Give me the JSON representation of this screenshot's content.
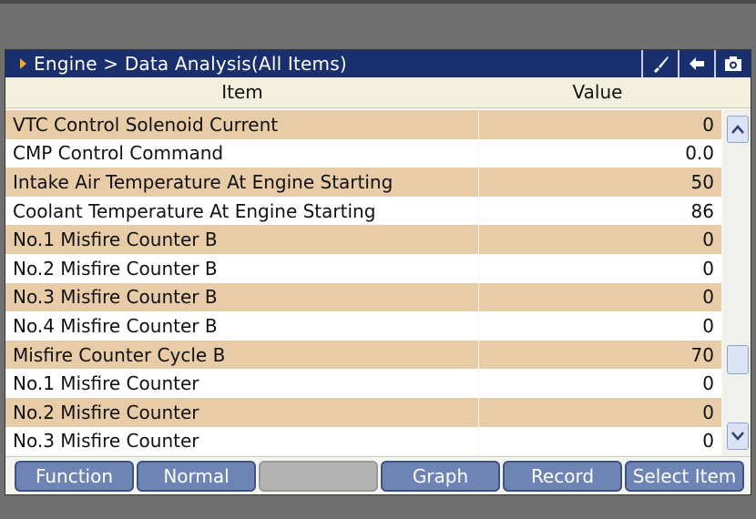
{
  "header": {
    "breadcrumb": "Engine > Data Analysis(All Items)",
    "icons": [
      "brush-icon",
      "back-arrow-icon",
      "camera-icon"
    ]
  },
  "columns": {
    "item": "Item",
    "value": "Value"
  },
  "rows": [
    {
      "item": "VTC Control Solenoid Current",
      "value": "0"
    },
    {
      "item": "CMP Control Command",
      "value": "0.0"
    },
    {
      "item": "Intake Air Temperature At Engine Starting",
      "value": "50"
    },
    {
      "item": "Coolant Temperature At Engine Starting",
      "value": "86"
    },
    {
      "item": "No.1 Misfire Counter B",
      "value": "0"
    },
    {
      "item": "No.2 Misfire Counter B",
      "value": "0"
    },
    {
      "item": "No.3 Misfire Counter B",
      "value": "0"
    },
    {
      "item": "No.4 Misfire Counter B",
      "value": "0"
    },
    {
      "item": "Misfire Counter Cycle B",
      "value": "70"
    },
    {
      "item": "No.1 Misfire Counter",
      "value": "0"
    },
    {
      "item": "No.2 Misfire Counter",
      "value": "0"
    },
    {
      "item": "No.3 Misfire Counter",
      "value": "0"
    }
  ],
  "buttons": {
    "function": "Function",
    "normal": "Normal",
    "blank": "",
    "graph": "Graph",
    "record": "Record",
    "select_item": "Select Item"
  },
  "colors": {
    "title_bg": "#1a2f6e",
    "row_alt": "#e8cca8",
    "row_plain": "#ffffff",
    "button": "#6e84b4",
    "arrow": "#f5a623"
  }
}
